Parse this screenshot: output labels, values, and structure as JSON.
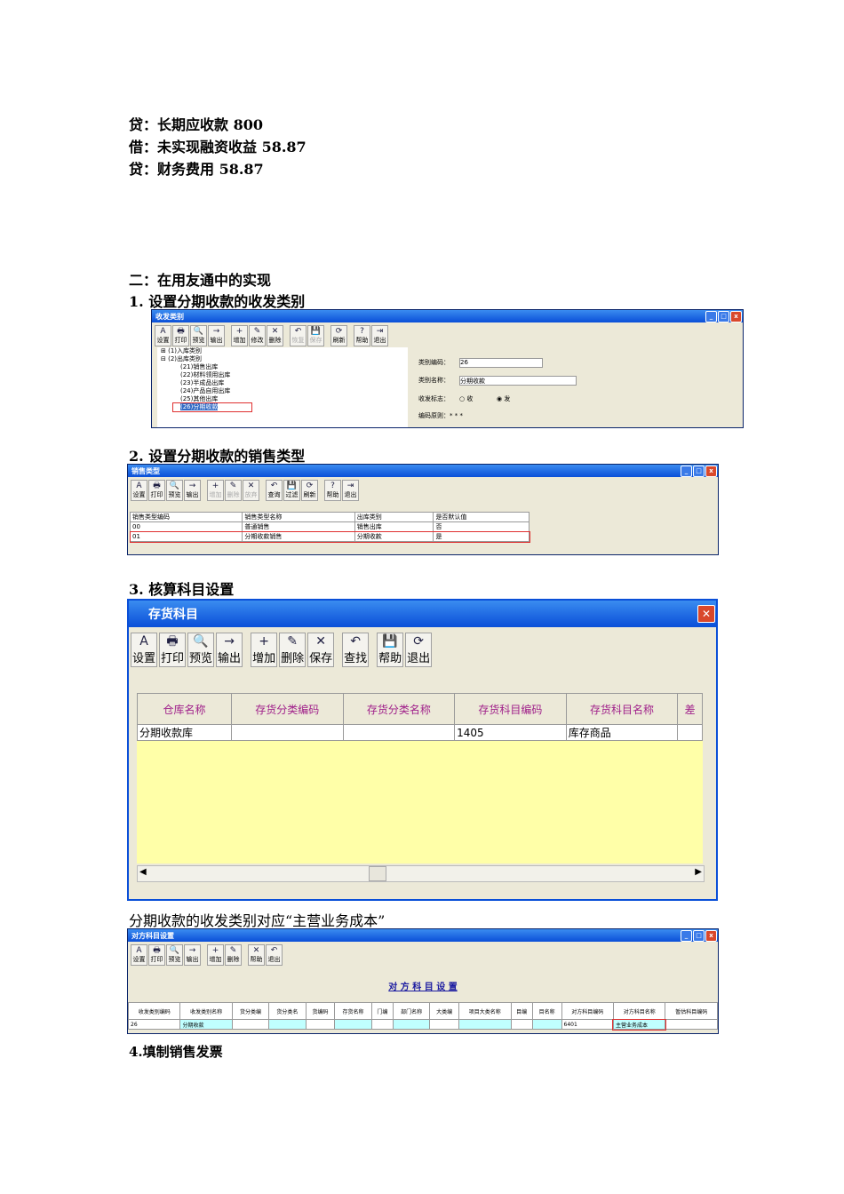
{
  "entries": [
    "贷：长期应收款  800",
    "借：未实现融资收益  58.87",
    "贷：财务费用  58.87"
  ],
  "section2": "二：在用友通中的实现",
  "step1": "1.   设置分期收款的收发类别",
  "step2": "2.   设置分期收款的销售类型",
  "step3": "3.   核算科目设置",
  "caption": "分期收款的收发类别对应“主营业务成本”",
  "step4": "4.填制销售发票",
  "win1": {
    "title": "收发类别",
    "tools": [
      "设置",
      "打印",
      "预览",
      "输出",
      "增加",
      "修改",
      "删除",
      "恢复",
      "保存",
      "刷新",
      "帮助",
      "退出"
    ],
    "tree": [
      "(1)入库类别",
      "(2)出库类别",
      "(21)销售出库",
      "(22)材料领用出库",
      "(23)半成品出库",
      "(24)产品自用出库",
      "(25)其他出库",
      "(26)分期收款"
    ],
    "code_label": "类别编码：",
    "code": "26",
    "name_label": "类别名称：",
    "name": "分期收款",
    "flag_label": "收发标志：",
    "flag_in": "收",
    "flag_out": "发",
    "rule": "编码原则：* * *"
  },
  "win2": {
    "title": "销售类型",
    "tools": [
      "设置",
      "打印",
      "预览",
      "输出",
      "增加",
      "删除",
      "放弃",
      "查询",
      "过滤",
      "刷新",
      "帮助",
      "退出"
    ],
    "headers": [
      "销售类型编码",
      "销售类型名称",
      "出库类别",
      "是否默认值"
    ],
    "rows": [
      [
        "00",
        "普通销售",
        "销售出库",
        "否"
      ],
      [
        "01",
        "分期收款销售",
        "分期收款",
        "是"
      ]
    ]
  },
  "win3": {
    "title": "存货科目",
    "tools": [
      "设置",
      "打印",
      "预览",
      "输出",
      "增加",
      "删除",
      "保存",
      "查找",
      "帮助",
      "退出"
    ],
    "headers": [
      "仓库名称",
      "存货分类编码",
      "存货分类名称",
      "存货科目编码",
      "存货科目名称",
      "差"
    ],
    "row": [
      "分期收款库",
      "",
      "",
      "1405",
      "库存商品",
      ""
    ]
  },
  "win4": {
    "title": "对方科目设置",
    "heading": "对 方 科 目 设 置",
    "tools": [
      "设置",
      "打印",
      "预览",
      "输出",
      "增加",
      "删除",
      "帮助",
      "退出"
    ],
    "headers": [
      "收发类别编码",
      "收发类别名称",
      "货分类编",
      "货分类名",
      "货编码",
      "存货名称",
      "门编",
      "部门名称",
      "大类编",
      "项目大类名称",
      "目编",
      "目名称",
      "对方科目编码",
      "对方科目名称",
      "暂估科目编码"
    ],
    "row": [
      "26",
      "分期收款",
      "",
      "",
      "",
      "",
      "",
      "",
      "",
      "",
      "",
      "",
      "6401",
      "主营业务成本",
      ""
    ]
  }
}
